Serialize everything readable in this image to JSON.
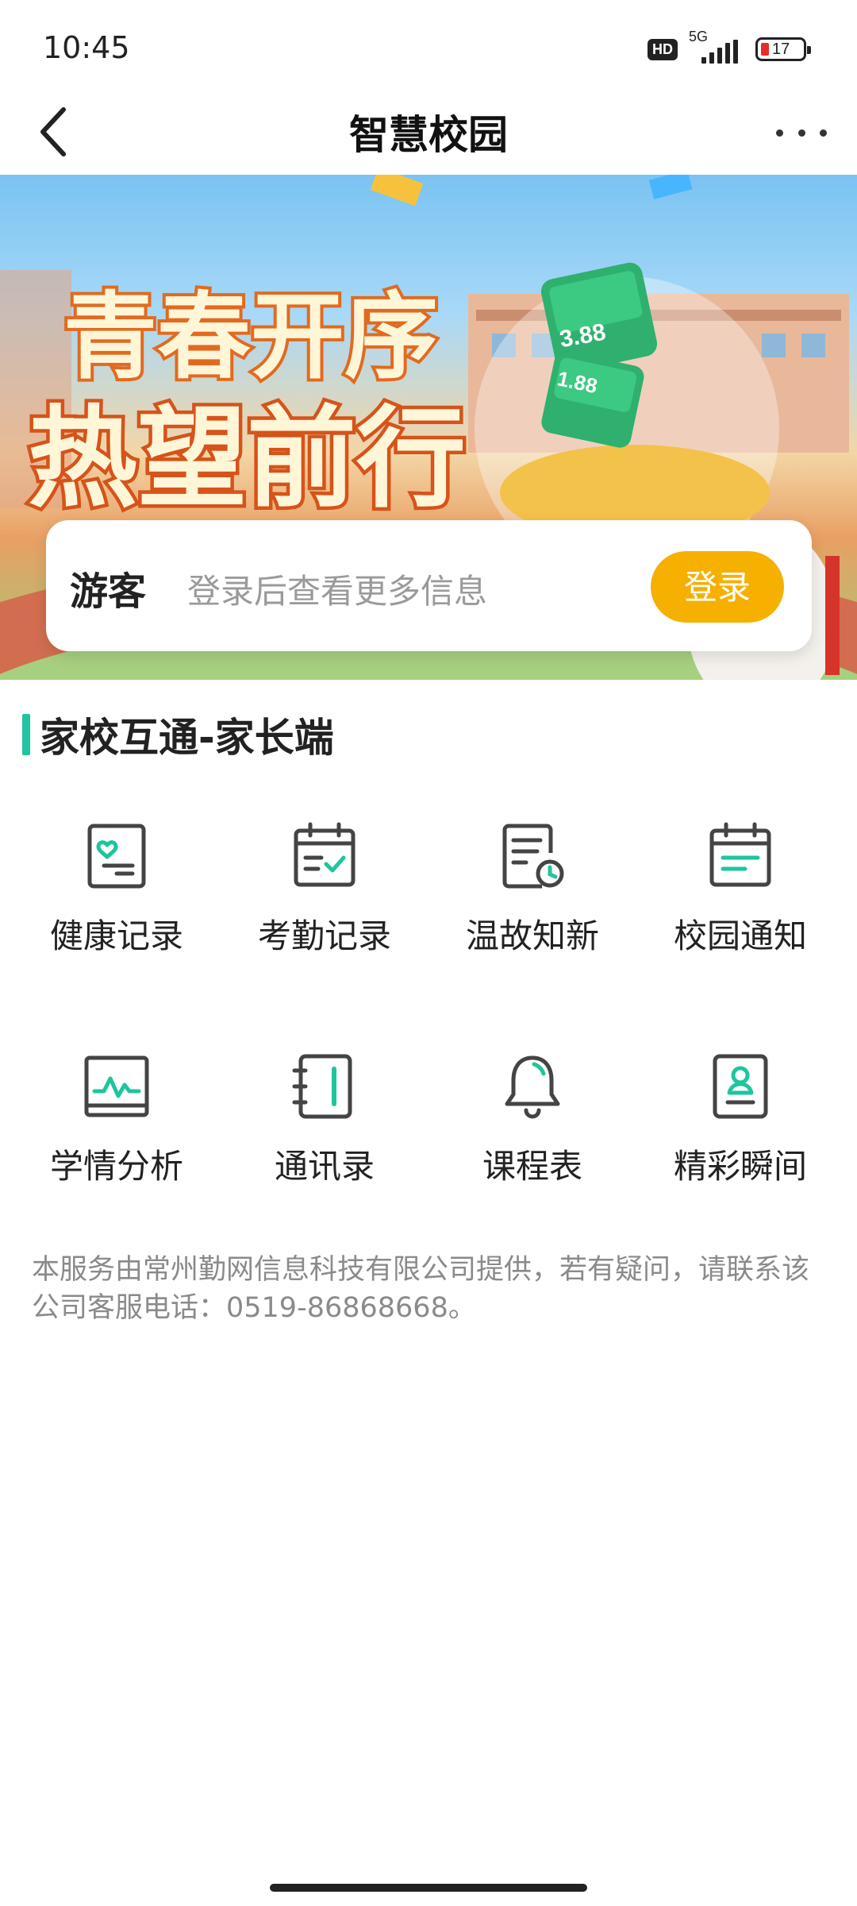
{
  "status_bar": {
    "time": "10:45",
    "hd_badge": "HD",
    "network": "5G",
    "battery": "17"
  },
  "nav": {
    "title": "智慧校园"
  },
  "banner": {
    "slogan_line1": "青春开序",
    "slogan_line2": "热望前行",
    "coupon_1": "1.88",
    "coupon_2": "3.88"
  },
  "login_card": {
    "guest_label": "游客",
    "hint": "登录后查看更多信息",
    "login_button": "登录"
  },
  "section": {
    "title": "家校互通-家长端",
    "accent_color": "#1ec59d"
  },
  "features": [
    {
      "label": "健康记录",
      "icon": "health-record-icon"
    },
    {
      "label": "考勤记录",
      "icon": "attendance-calendar-icon"
    },
    {
      "label": "温故知新",
      "icon": "review-document-clock-icon"
    },
    {
      "label": "校园通知",
      "icon": "notice-calendar-icon"
    },
    {
      "label": "学情分析",
      "icon": "analysis-chart-icon"
    },
    {
      "label": "通讯录",
      "icon": "contacts-book-icon"
    },
    {
      "label": "课程表",
      "icon": "bell-icon"
    },
    {
      "label": "精彩瞬间",
      "icon": "badge-profile-icon"
    }
  ],
  "footer": {
    "note": "本服务由常州勤网信息科技有限公司提供，若有疑问，请联系该公司客服电话：0519-86868668。"
  },
  "colors": {
    "primary_green": "#1ec59d",
    "login_orange": "#f5b000"
  }
}
